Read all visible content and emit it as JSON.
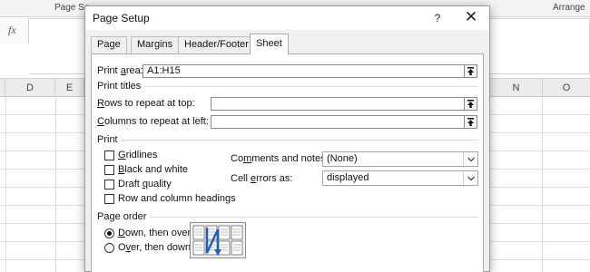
{
  "excel": {
    "ribbon_groups": [
      "Page Se",
      "Arrange"
    ],
    "fx_symbol": "fx",
    "columns_left": [
      "D",
      "E"
    ],
    "columns_right": [
      "N",
      "O"
    ]
  },
  "dialog": {
    "title": "Page Setup",
    "help_glyph": "?",
    "close_glyph": "✕",
    "tabs": [
      {
        "label": "Page",
        "active": false
      },
      {
        "label": "Margins",
        "active": false
      },
      {
        "label": "Header/Footer",
        "active": false
      },
      {
        "label": "Sheet",
        "active": true
      }
    ]
  },
  "sheet": {
    "print_area": {
      "label_pre": "Print ",
      "label_key": "a",
      "label_post": "rea:",
      "value": "A1:H15"
    },
    "print_titles": {
      "header": "Print titles",
      "rows_label_key": "R",
      "rows_label_post": "ows to repeat at top:",
      "rows_value": "",
      "cols_label_key": "C",
      "cols_label_post": "olumns to repeat at left:",
      "cols_value": ""
    },
    "print": {
      "header": "Print",
      "gridlines": {
        "key": "G",
        "rest": "ridlines",
        "checked": false
      },
      "black_white": {
        "key": "B",
        "rest": "lack and white",
        "checked": false
      },
      "draft_pre": "Draft ",
      "draft_key": "q",
      "draft_post": "uality",
      "draft_checked": false,
      "headings": "Row and column headings",
      "headings_checked": false,
      "comments_pre": "Co",
      "comments_key": "m",
      "comments_post": "ments and notes:",
      "comments_value": "(None)",
      "errors_pre": "Cell ",
      "errors_key": "e",
      "errors_post": "rrors as:",
      "errors_value": "displayed"
    },
    "page_order": {
      "header": "Page order",
      "down_key": "D",
      "down_rest": "own, then over",
      "down_selected": true,
      "over_pre": "O",
      "over_key": "v",
      "over_post": "er, then down",
      "over_selected": false
    }
  },
  "colors": {
    "accent_arrow": "#1f5fbf",
    "dialog_bg": "#f0f0f0"
  }
}
